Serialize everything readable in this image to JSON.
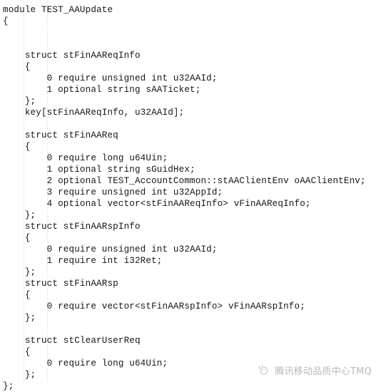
{
  "document": {
    "type": "source-code-listing",
    "language": "TARS interface definition",
    "background_color": "#ffffff",
    "text_color": "#151515",
    "indent_guide_color": "#c9c9c9",
    "lines": [
      "module TEST_AAUpdate",
      "{",
      "",
      "",
      "    struct stFinAAReqInfo",
      "    {",
      "        0 require unsigned int u32AAId;",
      "        1 optional string sAATicket;",
      "    };",
      "    key[stFinAAReqInfo, u32AAId];",
      "",
      "    struct stFinAAReq",
      "    {",
      "        0 require long u64Uin;",
      "        1 optional string sGuidHex;",
      "        2 optional TEST_AccountCommon::stAAClientEnv oAAClientEnv;",
      "        3 require unsigned int u32AppId;",
      "        4 optional vector<stFinAAReqInfo> vFinAAReqInfo;",
      "    };",
      "    struct stFinAARspInfo",
      "    {",
      "        0 require unsigned int u32AAId;",
      "        1 require int i32Ret;",
      "    };",
      "    struct stFinAARsp",
      "    {",
      "        0 require vector<stFinAARspInfo> vFinAARspInfo;",
      "    };",
      "",
      "    struct stClearUserReq",
      "    {",
      "        0 require long u64Uin;",
      "    };",
      "};"
    ]
  },
  "watermark": {
    "icon": "wechat-official-account-icon",
    "text": "腾讯移动品质中心TMQ",
    "color": "#8d8d8d"
  }
}
